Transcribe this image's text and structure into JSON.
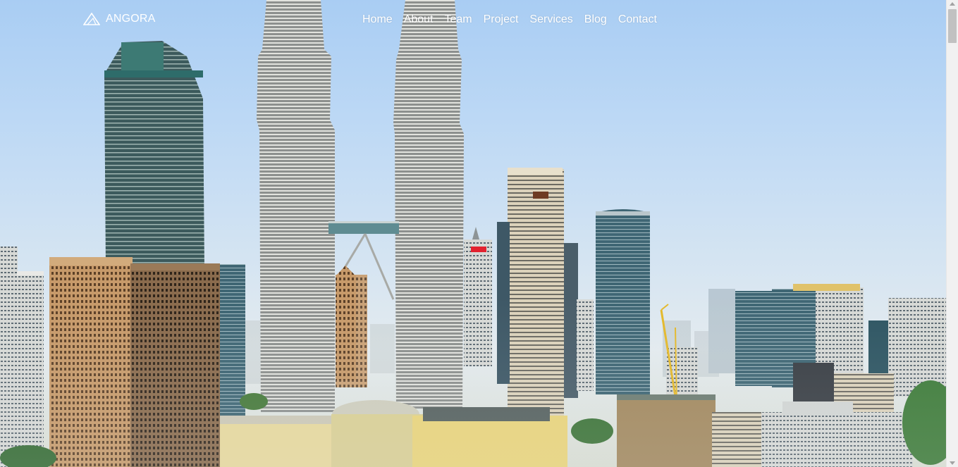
{
  "brand": {
    "name": "ANGORA",
    "logo_icon": "triangle-logo-icon"
  },
  "nav": {
    "items": [
      {
        "label": "Home"
      },
      {
        "label": "About"
      },
      {
        "label": "Team"
      },
      {
        "label": "Project"
      },
      {
        "label": "Services"
      },
      {
        "label": "Blog"
      },
      {
        "label": "Contact"
      }
    ]
  },
  "hero": {
    "image": "city-skyline-photo"
  },
  "colors": {
    "nav_text": "#ffffff",
    "sky_top": "#a9cdf3",
    "sky_bottom": "#e4ebef"
  }
}
